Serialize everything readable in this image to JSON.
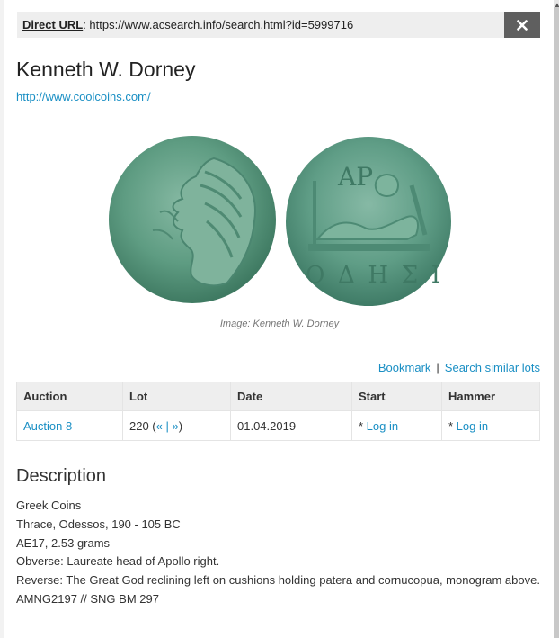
{
  "urlbar": {
    "label": "Direct URL",
    "url": "https://www.acsearch.info/search.html?id=5999716"
  },
  "dealer": {
    "name": "Kenneth W. Dorney",
    "website": "http://www.coolcoins.com/"
  },
  "image": {
    "caption": "Image: Kenneth W. Dorney",
    "reverse_inscription_top": "ΑΡ",
    "reverse_inscription_bottom": "ΟΔΗΣΙ"
  },
  "actions": {
    "bookmark": "Bookmark",
    "separator": "|",
    "similar": "Search similar lots"
  },
  "table": {
    "headers": [
      "Auction",
      "Lot",
      "Date",
      "Start",
      "Hammer"
    ],
    "row": {
      "auction": "Auction 8",
      "lot_number": "220 (",
      "lot_prev": "«",
      "lot_sep": " | ",
      "lot_next": "»",
      "lot_close": ")",
      "date": "01.04.2019",
      "start_prefix": "* ",
      "start_link": "Log in",
      "hammer_prefix": "* ",
      "hammer_link": "Log in"
    }
  },
  "description": {
    "heading": "Description",
    "lines": [
      "Greek Coins",
      "Thrace, Odessos, 190 - 105 BC",
      "AE17, 2.53 grams",
      "Obverse: Laureate head of Apollo right.",
      "Reverse: The Great God reclining left on cushions holding patera and cornucopua, monogram above.",
      "AMNG2197 // SNG BM 297"
    ]
  },
  "colors": {
    "link": "#1a8fc4",
    "urlbar_bg": "#eeeeee",
    "close_bg": "#5f5f5f",
    "coin_patina": "#5e9c82"
  }
}
